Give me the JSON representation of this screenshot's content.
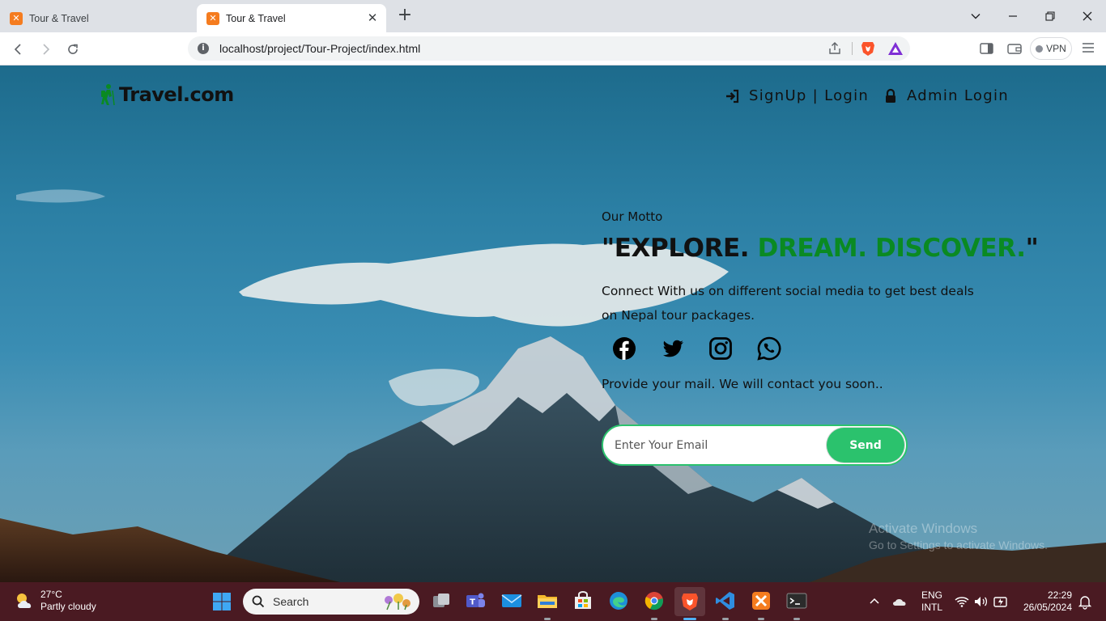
{
  "browser": {
    "tabs": [
      {
        "title": "Tour & Travel",
        "active": false
      },
      {
        "title": "Tour & Travel",
        "active": true
      }
    ],
    "new_tab": "+",
    "url": "localhost/project/Tour-Project/index.html",
    "vpn_label": "VPN"
  },
  "site": {
    "logo_text": "Travel.com",
    "nav": {
      "signup_login": "SignUp | Login",
      "admin_login": "Admin Login"
    },
    "hero": {
      "motto_label": "Our Motto",
      "quote_open": "\"",
      "word1": "EXPLORE.",
      "word2": "DREAM.",
      "word3": "DISCOVER.",
      "quote_close": "\"",
      "description": "Connect With us on different social media to get best deals on Nepal tour packages.",
      "social": [
        "facebook",
        "twitter",
        "instagram",
        "whatsapp"
      ],
      "provide_text": "Provide your mail. We will contact you soon..",
      "email_placeholder": "Enter Your Email",
      "send_label": "Send"
    }
  },
  "watermark": {
    "line1": "Activate Windows",
    "line2": "Go to Settings to activate Windows."
  },
  "taskbar": {
    "weather_temp": "27°C",
    "weather_desc": "Partly cloudy",
    "search_label": "Search",
    "lang_line1": "ENG",
    "lang_line2": "INTL",
    "time": "22:29",
    "date": "26/05/2024"
  },
  "colors": {
    "accent_green": "#0a8a22",
    "button_green": "#2bc26d",
    "taskbar": "#4a1a22"
  }
}
